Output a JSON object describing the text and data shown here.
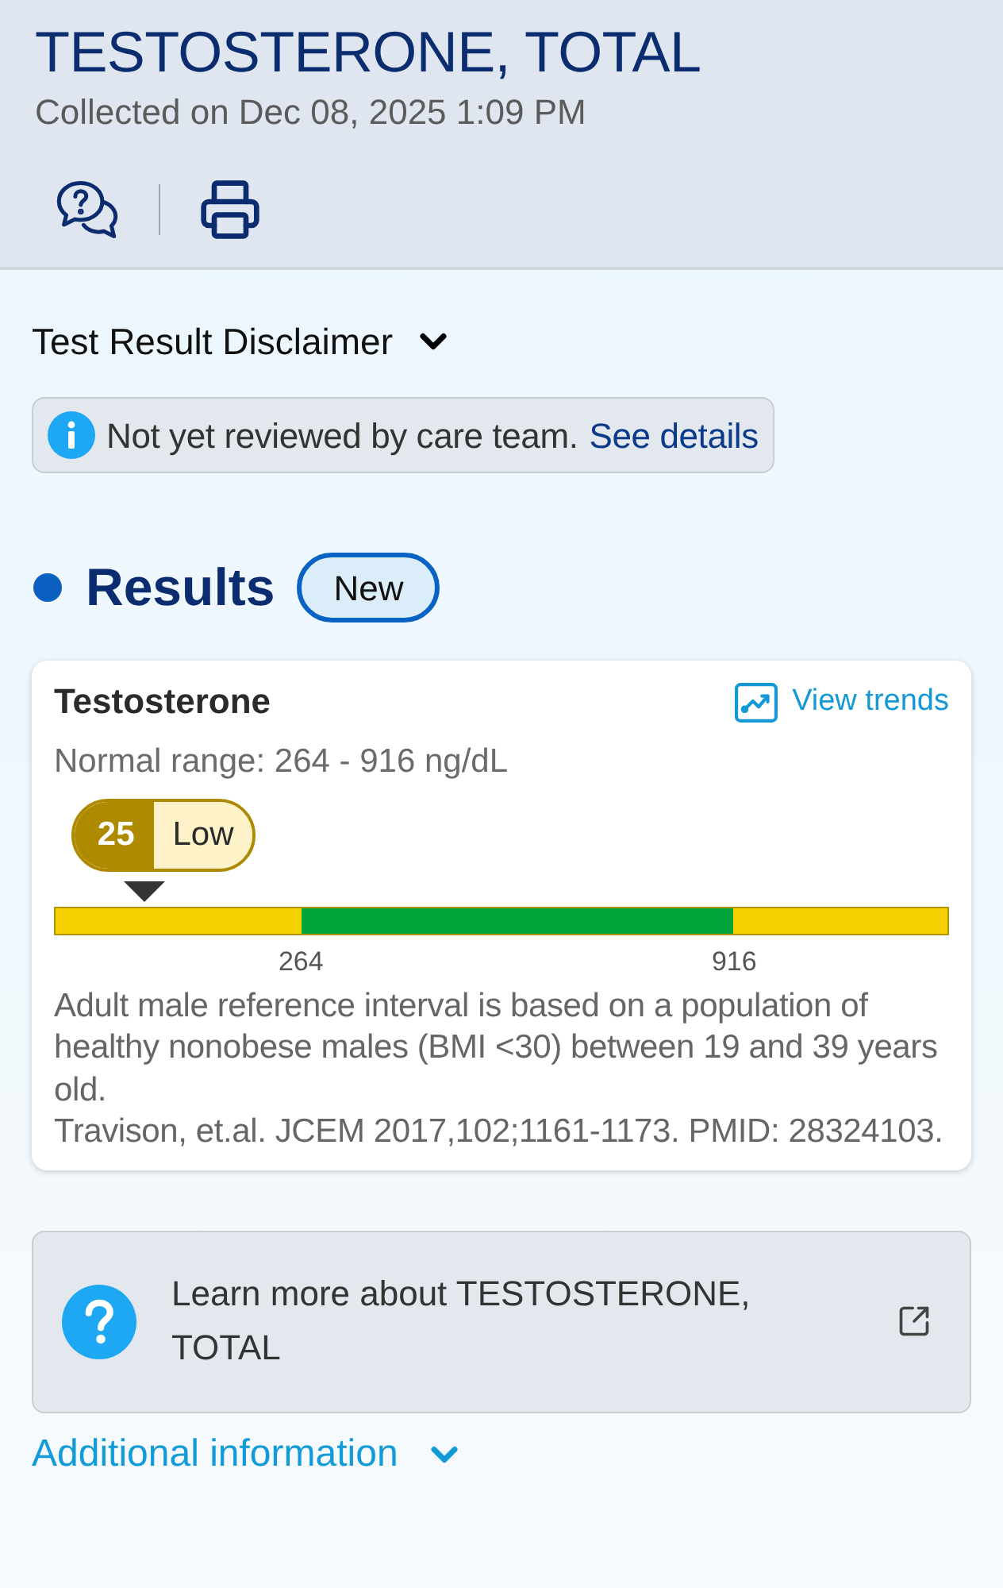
{
  "header": {
    "title": "TESTOSTERONE, TOTAL",
    "collected": "Collected on Dec 08, 2025 1:09 PM"
  },
  "disclaimer": {
    "label": "Test Result Disclaimer",
    "expanded": false
  },
  "review_notice": {
    "text": "Not yet reviewed by care team.",
    "link": "See details"
  },
  "results": {
    "heading": "Results",
    "badge": "New"
  },
  "result_card": {
    "name": "Testosterone",
    "trends_link": "View trends",
    "normal_range": "Normal range: 264 - 916 ng/dL",
    "value": "25",
    "flag": "Low",
    "range_bar": {
      "segments": [
        {
          "color": "#f5d100"
        },
        {
          "color": "#00a438"
        },
        {
          "color": "#f5d100"
        }
      ],
      "ticks": [
        "264",
        "916"
      ],
      "marker": {
        "level": 0.1
      }
    },
    "notes": [
      "Adult male reference interval is based on a population of healthy nonobese males (BMI <30) between 19 and 39 years old.",
      "Travison, et.al. JCEM 2017,102;1161-1173. PMID: 28324103."
    ]
  },
  "learn_more": {
    "text": "Learn more about TESTOSTERONE, TOTAL"
  },
  "additional_info": {
    "label": "Additional information",
    "expanded": false
  }
}
